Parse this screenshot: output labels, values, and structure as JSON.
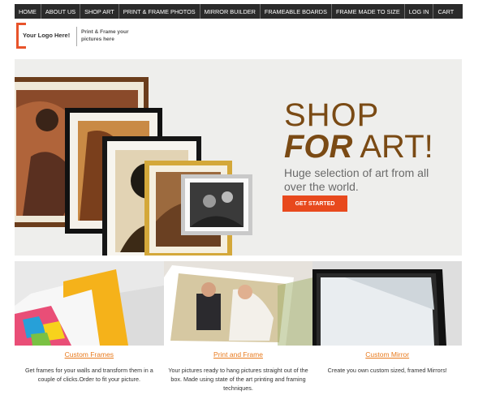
{
  "nav": {
    "items": [
      "HOME",
      "ABOUT US",
      "SHOP ART",
      "PRINT & FRAME PHOTOS",
      "MIRROR BUILDER",
      "FRAMEABLE BOARDS",
      "FRAME MADE TO SIZE",
      "LOG IN",
      "CART"
    ]
  },
  "logo": {
    "main": "Your Logo Here!",
    "tagline": "Print & Frame your pictures here"
  },
  "hero": {
    "line1": "SHOP",
    "line2_bold": "FOR",
    "line2_rest": " ART!",
    "subtitle": "Huge selection of art from all over the world.",
    "cta": "GET STARTED"
  },
  "features": [
    {
      "title": "Custom Frames",
      "desc": "Get frames for your walls and transform them  in a couple of clicks.Order to fit your picture."
    },
    {
      "title": "Print and Frame",
      "desc": "Your pictures ready to hang pictures straight out of the box. Made using state of the art printing and framing techniques."
    },
    {
      "title": "Custom Mirror",
      "desc": "Create you own custom sized, framed Mirrors!"
    }
  ],
  "colors": {
    "accent": "#e8491d",
    "brand_brown": "#7a4a14",
    "nav_bg": "#2b2b2b",
    "link": "#e87a1d"
  }
}
